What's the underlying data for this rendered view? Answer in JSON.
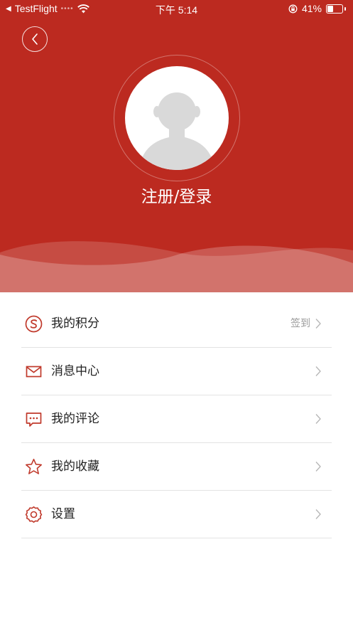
{
  "status_bar": {
    "back_app": "TestFlight",
    "time": "下午 5:14",
    "battery_percent": "41%",
    "battery_level": 0.41
  },
  "profile": {
    "login_label": "注册/登录"
  },
  "menu": {
    "items": [
      {
        "label": "我的积分",
        "extra": "签到",
        "icon": "points-icon"
      },
      {
        "label": "消息中心",
        "icon": "mail-icon"
      },
      {
        "label": "我的评论",
        "icon": "comment-icon"
      },
      {
        "label": "我的收藏",
        "icon": "star-icon"
      },
      {
        "label": "设置",
        "icon": "settings-icon"
      }
    ]
  },
  "colors": {
    "header_bg": "#bc2a20",
    "accent": "#c0392b",
    "divider": "#e3e3e3"
  }
}
